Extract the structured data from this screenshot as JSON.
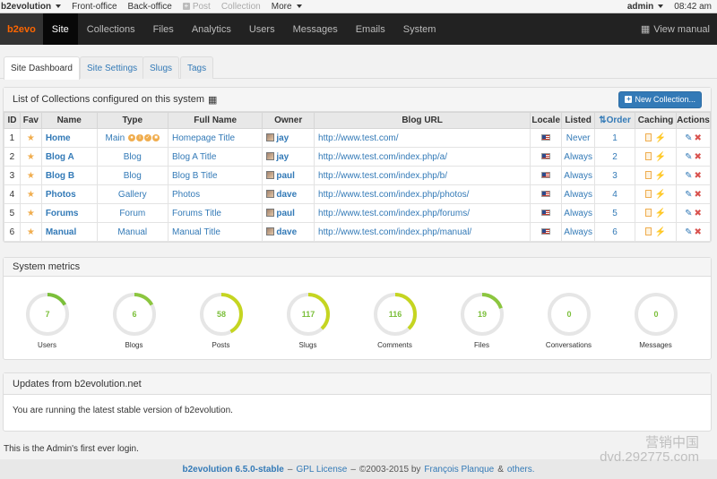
{
  "evobar": {
    "brand": "b2evolution",
    "front_office": "Front-office",
    "back_office": "Back-office",
    "post": "Post",
    "collection": "Collection",
    "more": "More",
    "user": "admin",
    "time": "08:42 am"
  },
  "mainnav": {
    "logo": "b2evo",
    "items": [
      "Site",
      "Collections",
      "Files",
      "Analytics",
      "Users",
      "Messages",
      "Emails",
      "System"
    ],
    "manual": "View manual"
  },
  "tabs": [
    "Site Dashboard",
    "Site Settings",
    "Slugs",
    "Tags"
  ],
  "collections": {
    "title": "List of Collections configured on this system",
    "new_button": "New Collection...",
    "columns": [
      "ID",
      "Fav",
      "Name",
      "Type",
      "Full Name",
      "Owner",
      "Blog URL",
      "Locale",
      "Listed",
      "Order",
      "Caching",
      "Actions"
    ],
    "rows": [
      {
        "id": "1",
        "name": "Home",
        "type": "Main",
        "full_name": "Homepage Title",
        "owner": "jay",
        "url": "http://www.test.com/",
        "listed": "Never",
        "order": "1"
      },
      {
        "id": "2",
        "name": "Blog A",
        "type": "Blog",
        "full_name": "Blog A Title",
        "owner": "jay",
        "url": "http://www.test.com/index.php/a/",
        "listed": "Always",
        "order": "2"
      },
      {
        "id": "3",
        "name": "Blog B",
        "type": "Blog",
        "full_name": "Blog B Title",
        "owner": "paul",
        "url": "http://www.test.com/index.php/b/",
        "listed": "Always",
        "order": "3"
      },
      {
        "id": "4",
        "name": "Photos",
        "type": "Gallery",
        "full_name": "Photos",
        "owner": "dave",
        "url": "http://www.test.com/index.php/photos/",
        "listed": "Always",
        "order": "4"
      },
      {
        "id": "5",
        "name": "Forums",
        "type": "Forum",
        "full_name": "Forums Title",
        "owner": "paul",
        "url": "http://www.test.com/index.php/forums/",
        "listed": "Always",
        "order": "5"
      },
      {
        "id": "6",
        "name": "Manual",
        "type": "Manual",
        "full_name": "Manual Title",
        "owner": "dave",
        "url": "http://www.test.com/index.php/manual/",
        "listed": "Always",
        "order": "6"
      }
    ]
  },
  "metrics": {
    "title": "System metrics",
    "items": [
      {
        "label": "Users",
        "value": "7",
        "fill": 0.17,
        "color": "#7bbf3a"
      },
      {
        "label": "Blogs",
        "value": "6",
        "fill": 0.17,
        "color": "#8cc63f"
      },
      {
        "label": "Posts",
        "value": "58",
        "fill": 0.42,
        "color": "#c5d521"
      },
      {
        "label": "Slugs",
        "value": "117",
        "fill": 0.38,
        "color": "#c5d521"
      },
      {
        "label": "Comments",
        "value": "116",
        "fill": 0.38,
        "color": "#c5d521"
      },
      {
        "label": "Files",
        "value": "19",
        "fill": 0.2,
        "color": "#8cc63f"
      },
      {
        "label": "Conversations",
        "value": "0",
        "fill": 0,
        "color": "#7bbf3a"
      },
      {
        "label": "Messages",
        "value": "0",
        "fill": 0,
        "color": "#7bbf3a"
      }
    ]
  },
  "updates": {
    "title": "Updates from b2evolution.net",
    "text": "You are running the latest stable version of b2evolution."
  },
  "first_login": "This is the Admin's first ever login.",
  "footer": {
    "version": "b2evolution 6.5.0-stable",
    "license": "GPL License",
    "copyright": "©2003-2015 by",
    "author": "François Planque",
    "others": "others."
  },
  "watermark": {
    "line1": "营销中国",
    "line2": "dvd.292775.com"
  }
}
